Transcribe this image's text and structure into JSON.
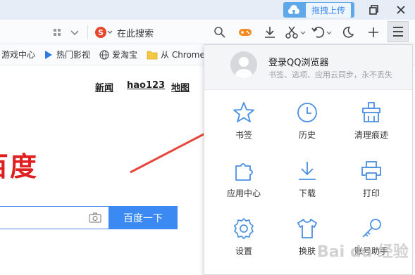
{
  "titlebar": {
    "upload_label": "拖拽上传"
  },
  "toolbar": {
    "search_placeholder": "在此搜索"
  },
  "bookmarks": [
    {
      "label": "游戏中心"
    },
    {
      "label": "热门影视"
    },
    {
      "label": "爱淘宝"
    },
    {
      "label": "从 Chrome"
    }
  ],
  "nav_links": [
    "新闻",
    "hao123",
    "地图"
  ],
  "baidu": {
    "logo_text": "百度",
    "search_button": "百度一下"
  },
  "menu": {
    "login_title": "登录QQ浏览器",
    "login_subtitle": "书签、选项、应用云同步，永不丢失",
    "items": [
      {
        "label": "书签",
        "icon": "star-icon"
      },
      {
        "label": "历史",
        "icon": "clock-icon"
      },
      {
        "label": "清理痕迹",
        "icon": "broom-icon"
      },
      {
        "label": "应用中心",
        "icon": "puzzle-icon"
      },
      {
        "label": "下载",
        "icon": "download-icon"
      },
      {
        "label": "打印",
        "icon": "printer-icon"
      },
      {
        "label": "设置",
        "icon": "gear-icon"
      },
      {
        "label": "换肤",
        "icon": "shirt-icon"
      },
      {
        "label": "账号助手",
        "icon": "key-icon"
      }
    ]
  },
  "watermark": "Bai du 经验",
  "colors": {
    "accent": "#3b89f2",
    "menu_icon": "#4a90e2",
    "logo_red": "#e02020",
    "arrow": "#e8453c"
  }
}
